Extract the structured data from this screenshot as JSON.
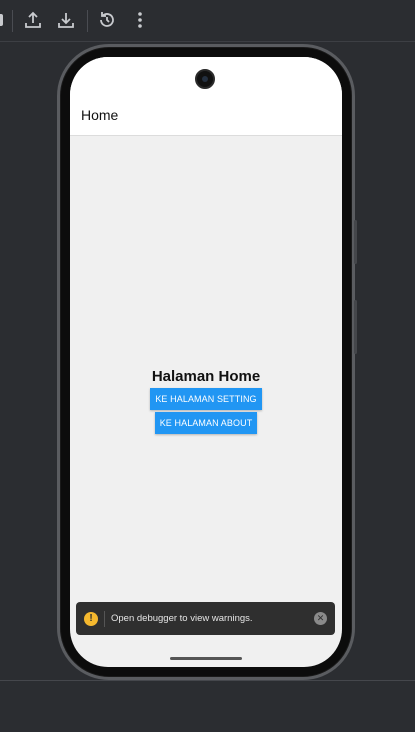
{
  "toolbar": {
    "icons": [
      "upload-icon",
      "download-icon",
      "rotate-icon",
      "more-vertical-icon"
    ]
  },
  "app": {
    "appbar_title": "Home",
    "heading": "Halaman Home",
    "buttons": {
      "setting_label": "KE HALAMAN SETTING",
      "about_label": "KE HALAMAN ABOUT"
    },
    "accent_color": "#2196f3"
  },
  "toast": {
    "icon": "warning-icon",
    "message": "Open debugger to view warnings.",
    "close_icon": "close-icon"
  }
}
